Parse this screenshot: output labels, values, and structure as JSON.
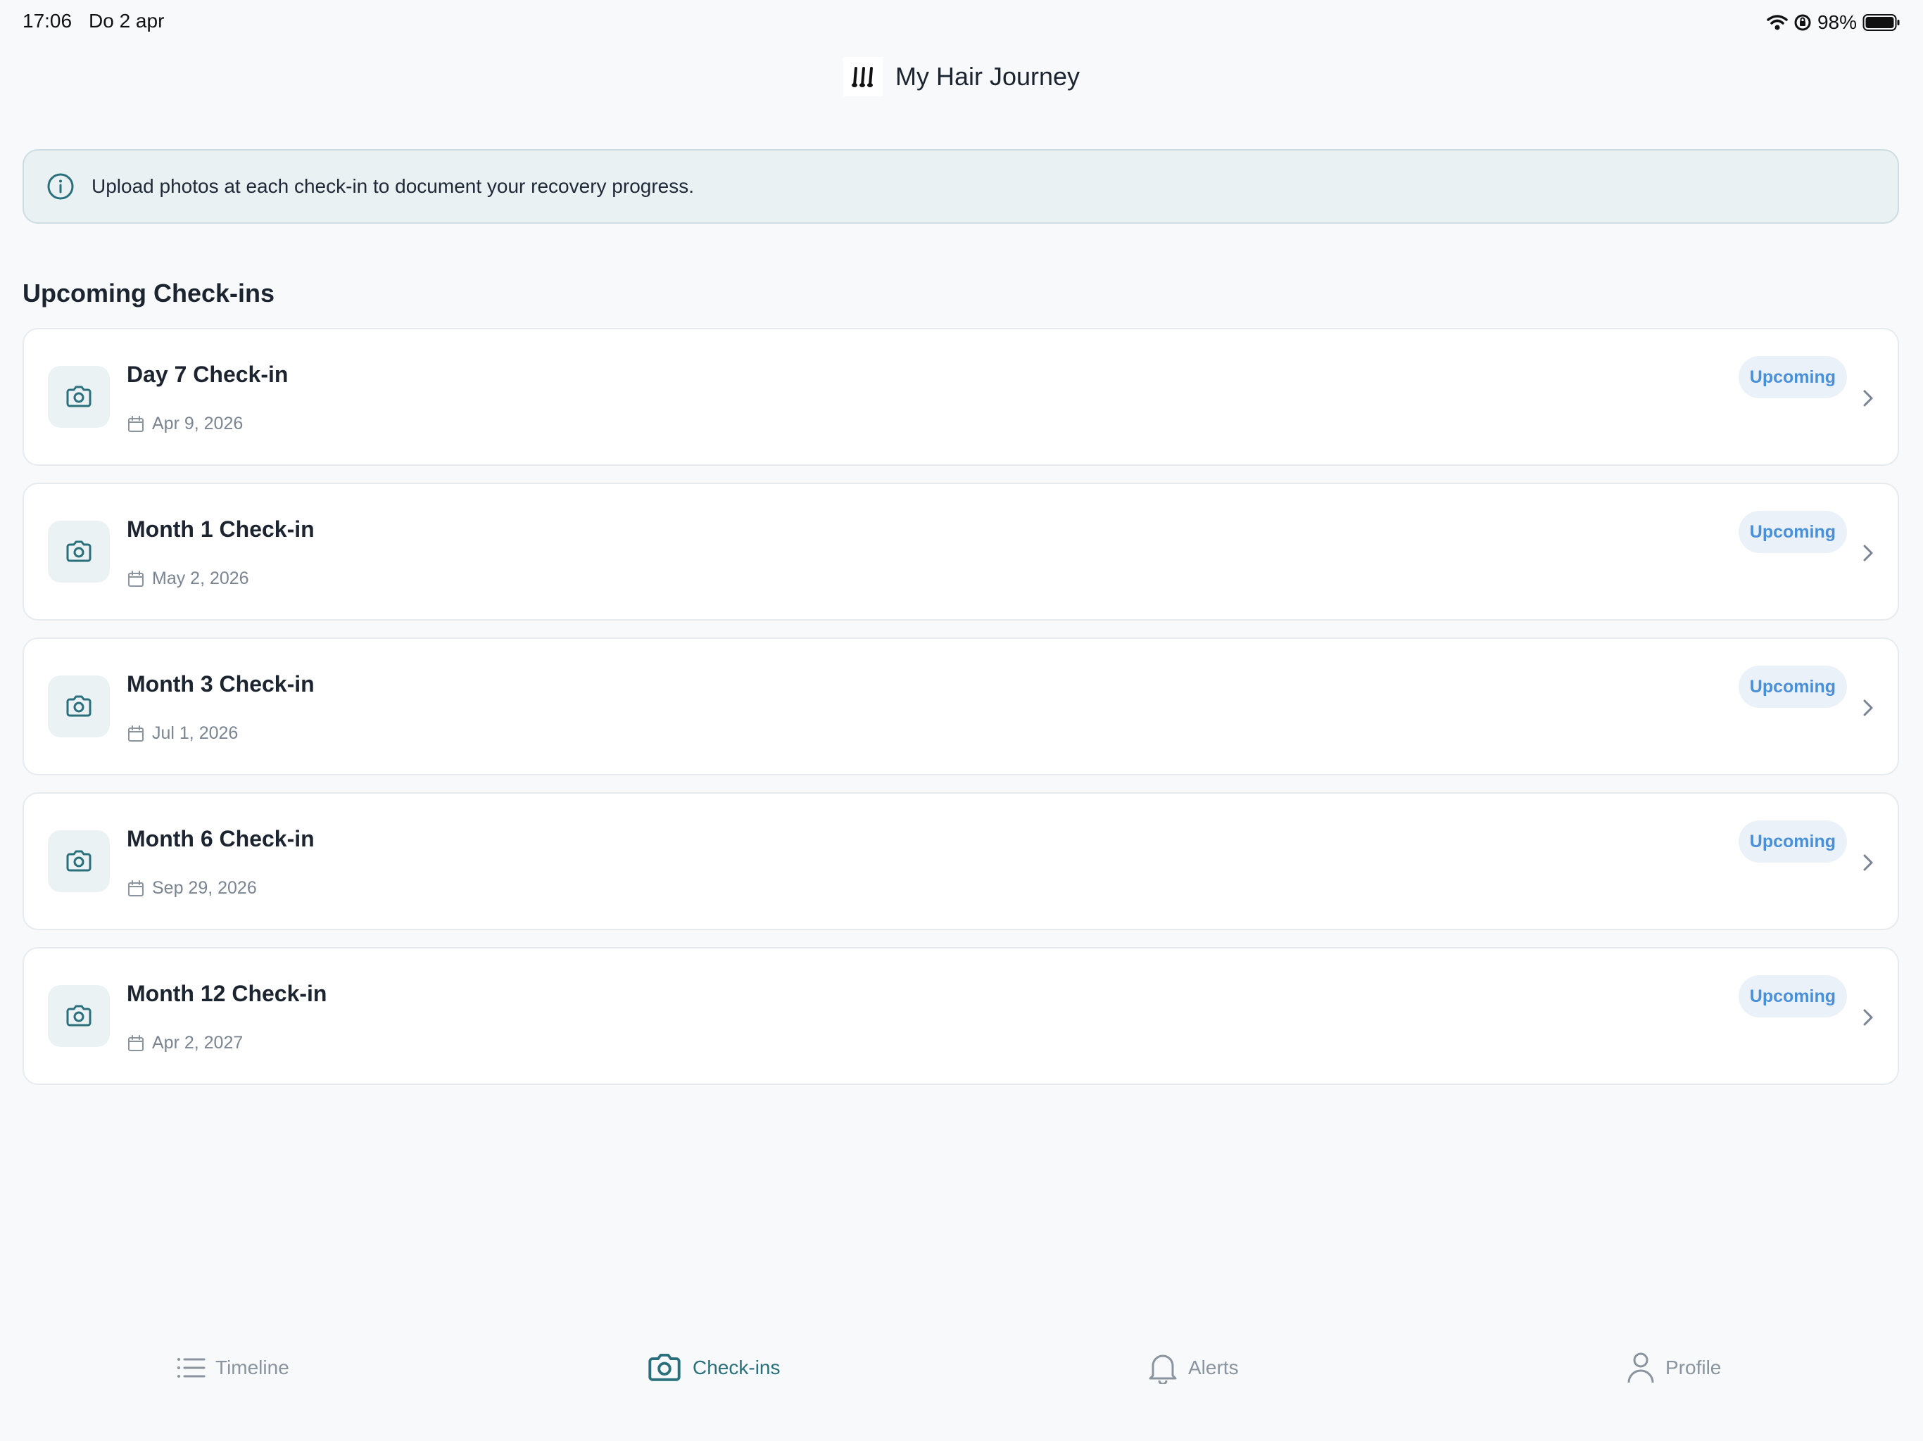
{
  "status_bar": {
    "time": "17:06",
    "date": "Do 2 apr",
    "battery": "98%"
  },
  "header": {
    "logo_icon": "hair-strands-icon",
    "title": "My Hair Journey"
  },
  "info_banner": {
    "icon": "info-icon",
    "text": "Upload photos at each check-in to document your recovery progress."
  },
  "section": {
    "title": "Upcoming Check-ins"
  },
  "checkins": [
    {
      "title": "Day 7 Check-in",
      "date": "Apr 9, 2026",
      "status": "Upcoming"
    },
    {
      "title": "Month 1 Check-in",
      "date": "May 2, 2026",
      "status": "Upcoming"
    },
    {
      "title": "Month 3 Check-in",
      "date": "Jul 1, 2026",
      "status": "Upcoming"
    },
    {
      "title": "Month 6 Check-in",
      "date": "Sep 29, 2026",
      "status": "Upcoming"
    },
    {
      "title": "Month 12 Check-in",
      "date": "Apr 2, 2027",
      "status": "Upcoming"
    }
  ],
  "tab_bar": {
    "tabs": [
      {
        "label": "Timeline",
        "icon": "list-icon",
        "active": false
      },
      {
        "label": "Check-ins",
        "icon": "camera-icon",
        "active": true
      },
      {
        "label": "Alerts",
        "icon": "bell-icon",
        "active": false
      },
      {
        "label": "Profile",
        "icon": "person-icon",
        "active": false
      }
    ]
  },
  "colors": {
    "accent": "#2a6f7c",
    "badge_text": "#4a90d9",
    "badge_bg": "#eaf1f8",
    "banner_bg": "#e9f1f3",
    "page_bg": "#f7f9fb"
  }
}
